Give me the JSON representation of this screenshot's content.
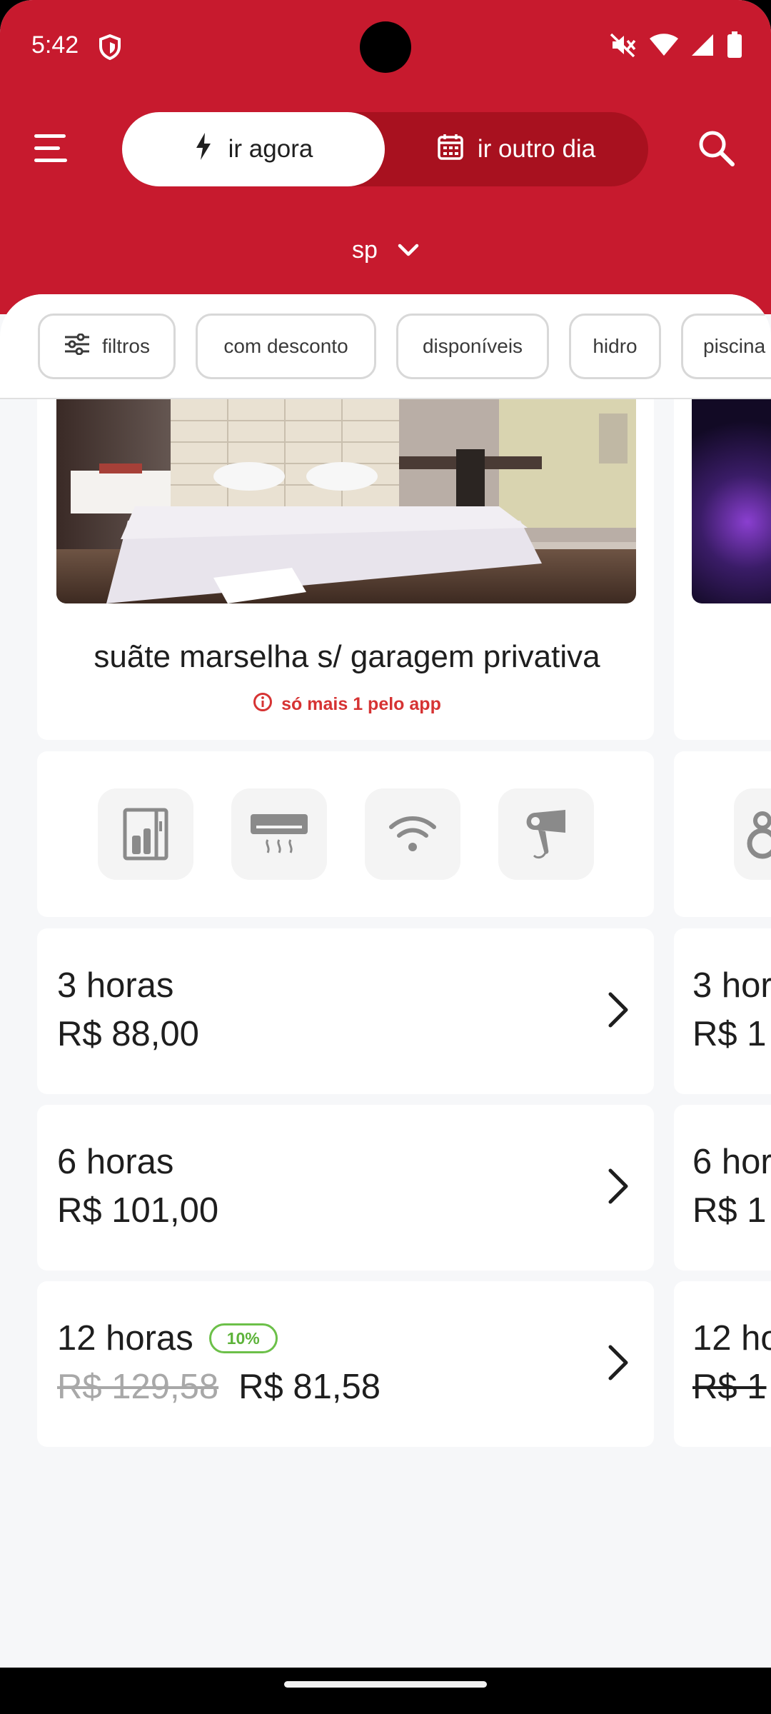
{
  "status_bar": {
    "time": "5:42",
    "icons": [
      "shield-icon",
      "mute-icon",
      "wifi-icon",
      "signal-icon",
      "battery-icon"
    ]
  },
  "header": {
    "background_color": "#c71a2e",
    "menu_icon": "hamburger-menu-icon",
    "mode_toggle": {
      "now_label": "ir agora",
      "later_label": "ir outro dia",
      "selected": "ir agora"
    },
    "search_icon": "search-icon",
    "city": "sp"
  },
  "filters": {
    "chips": [
      {
        "label": "filtros",
        "icon": "sliders-icon"
      },
      {
        "label": "com desconto"
      },
      {
        "label": "disponíveis"
      },
      {
        "label": "hidro"
      },
      {
        "label": "piscina"
      }
    ]
  },
  "room": {
    "name": "suãte marselha s/ garagem privativa",
    "alert": "só mais 1 pelo app",
    "amenities": [
      {
        "icon": "minibar-fridge-icon"
      },
      {
        "icon": "air-conditioner-icon"
      },
      {
        "icon": "wifi-icon"
      },
      {
        "icon": "hair-dryer-icon"
      }
    ],
    "prices": [
      {
        "hours": "3 horas",
        "price": "R$ 88,00"
      },
      {
        "hours": "6 horas",
        "price": "R$ 101,00"
      },
      {
        "hours": "12 horas",
        "badge": "10%",
        "old_price": "R$ 129,58",
        "price": "R$ 81,58"
      }
    ]
  },
  "next_room_peek": {
    "prices": [
      {
        "hours": "3 hor",
        "price": "R$ 1"
      },
      {
        "hours": "6 hor",
        "price": "R$ 1"
      },
      {
        "hours": "12 ho",
        "old_price": "R$ 1"
      }
    ]
  },
  "colors": {
    "brand_red": "#c71a2e",
    "alert_red": "#d63333",
    "discount_green": "#6cc049"
  }
}
